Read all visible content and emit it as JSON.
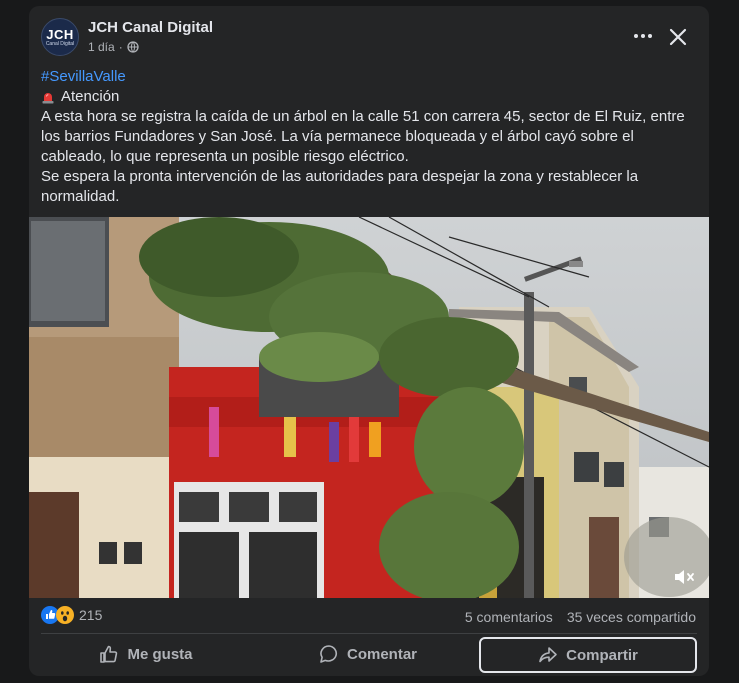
{
  "post": {
    "author": "JCH Canal Digital",
    "avatar_text": "JCH",
    "avatar_subtext": "Canal Digital",
    "time": "1 día",
    "separator": "·",
    "hashtag": "#SevillaValle",
    "attention": "Atención",
    "body_1": "A esta hora se registra la caída de un árbol en la calle 51 con carrera 45, sector de El Ruiz, entre los barrios Fundadores y San José. La vía permanece bloqueada y el árbol cayó sobre el cableado, lo que representa un posible riesgo eléctrico.",
    "body_2": "Se espera la pronta intervención de las autoridades para despejar la zona y restablecer la normalidad."
  },
  "icons": {
    "more": "more-dots-icon",
    "close": "close-icon",
    "privacy": "globe-icon",
    "siren": "siren-icon",
    "mute": "speaker-muted-icon",
    "reactions": [
      "like-reaction-icon",
      "wow-reaction-icon"
    ]
  },
  "engagement": {
    "reaction_count": "215",
    "comments": "5 comentarios",
    "shares": "35 veces compartido"
  },
  "actions": {
    "like": "Me gusta",
    "comment": "Comentar",
    "share": "Compartir"
  },
  "colors": {
    "background": "#18191a",
    "card": "#242526",
    "text": "#e4e6eb",
    "secondary_text": "#b0b3b8",
    "hashtag": "#4599ff",
    "like_blue": "#1877f2",
    "wow_yellow": "#f7b125"
  }
}
